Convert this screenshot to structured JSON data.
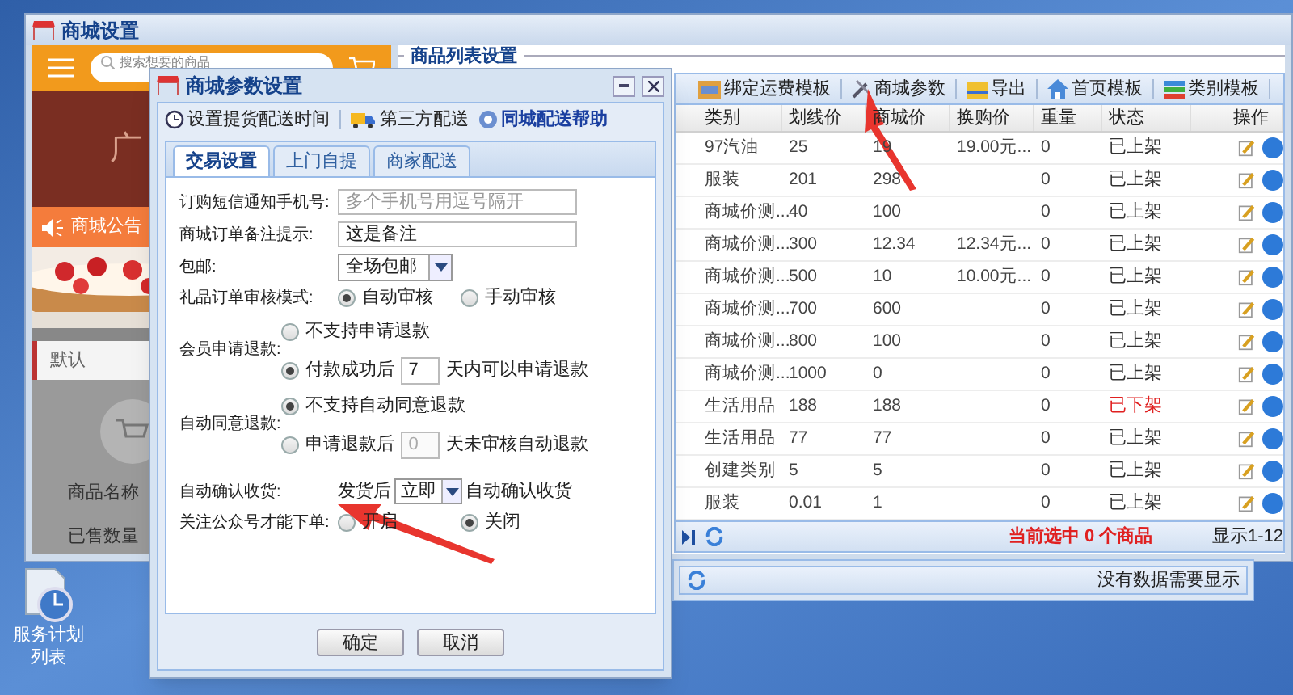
{
  "desktop_icon": {
    "label": "服务计划列表"
  },
  "main_window": {
    "title": "商城设置"
  },
  "preview": {
    "search": {
      "placeholder": "搜索想要的商品"
    },
    "banner": "广",
    "notice": "商城公告",
    "category": "默认",
    "product_name": "商品名称",
    "sold_count": "已售数量"
  },
  "product_list": {
    "title": "商品列表设置",
    "toolbar": [
      "绑定运费模板",
      "商城参数",
      "导出",
      "首页模板",
      "类别模板"
    ],
    "columns": [
      "类别",
      "划线价",
      "商城价",
      "换购价",
      "重量",
      "状态",
      "操作"
    ],
    "rows": [
      {
        "cells": [
          "97汽油",
          "25",
          "19",
          "19.00元...",
          "0"
        ],
        "status": "已上架",
        "listed": true
      },
      {
        "cells": [
          "服装",
          "201",
          "298",
          "",
          "0"
        ],
        "status": "已上架",
        "listed": true
      },
      {
        "cells": [
          "商城价测...",
          "40",
          "100",
          "",
          "0"
        ],
        "status": "已上架",
        "listed": true
      },
      {
        "cells": [
          "商城价测...",
          "300",
          "12.34",
          "12.34元...",
          "0"
        ],
        "status": "已上架",
        "listed": true
      },
      {
        "cells": [
          "商城价测...",
          "500",
          "10",
          "10.00元...",
          "0"
        ],
        "status": "已上架",
        "listed": true
      },
      {
        "cells": [
          "商城价测...",
          "700",
          "600",
          "",
          "0"
        ],
        "status": "已上架",
        "listed": true
      },
      {
        "cells": [
          "商城价测...",
          "800",
          "100",
          "",
          "0"
        ],
        "status": "已上架",
        "listed": true
      },
      {
        "cells": [
          "商城价测...",
          "1000",
          "0",
          "",
          "0"
        ],
        "status": "已上架",
        "listed": true
      },
      {
        "cells": [
          "生活用品",
          "188",
          "188",
          "",
          "0"
        ],
        "status": "已下架",
        "listed": false
      },
      {
        "cells": [
          "生活用品",
          "77",
          "77",
          "",
          "0"
        ],
        "status": "已上架",
        "listed": true
      },
      {
        "cells": [
          "创建类别",
          "5",
          "5",
          "",
          "0"
        ],
        "status": "已上架",
        "listed": true
      },
      {
        "cells": [
          "服装",
          "0.01",
          "1",
          "",
          "0"
        ],
        "status": "已上架",
        "listed": true
      }
    ],
    "selection": "当前选中 0 个商品",
    "range": "显示1-12",
    "empty_message": "没有数据需要显示"
  },
  "dialog": {
    "title": "商城参数设置",
    "toolbar": [
      {
        "kind": "clock",
        "label": "设置提货配送时间"
      },
      {
        "kind": "truck",
        "label": "第三方配送"
      },
      {
        "kind": "help",
        "label": "同城配送帮助"
      }
    ],
    "tabs": [
      {
        "label": "交易设置",
        "selected": true
      },
      {
        "label": "上门自提",
        "selected": false
      },
      {
        "label": "商家配送",
        "selected": false
      }
    ],
    "fields": [
      {
        "kind": "input",
        "label": "订购短信通知手机号:",
        "placeholder": "多个手机号用逗号隔开"
      },
      {
        "kind": "input",
        "label": "商城订单备注提示:",
        "value": "这是备注"
      },
      {
        "kind": "select",
        "label": "包邮:",
        "value": "全场包邮"
      },
      {
        "kind": "radio",
        "label": "礼品订单审核模式:",
        "options": [
          {
            "label": "自动审核",
            "selected": true
          },
          {
            "label": "手动审核",
            "selected": false
          }
        ]
      },
      {
        "kind": "radio-stack",
        "label": "会员申请退款:",
        "options": [
          {
            "label": "不支持申请退款",
            "selected": false
          },
          {
            "label": "付款成功后",
            "input": {
              "value": "7",
              "disabled": false
            },
            "suffix": "天内可以申请退款",
            "selected": true
          }
        ]
      },
      {
        "kind": "radio-stack",
        "label": "自动同意退款:",
        "options": [
          {
            "label": "不支持自动同意退款",
            "selected": true
          },
          {
            "label": "申请退款后",
            "input": {
              "value": "0",
              "disabled": true
            },
            "suffix": "天未审核自动退款",
            "selected": false
          }
        ]
      },
      {
        "kind": "inline-select",
        "label": "自动确认收货:",
        "prefix": "发货后",
        "value": "立即",
        "suffix": "自动确认收货"
      },
      {
        "kind": "radio",
        "label": "关注公众号才能下单:",
        "options": [
          {
            "label": "开启",
            "selected": false
          },
          {
            "label": "关闭",
            "selected": true
          }
        ]
      }
    ],
    "buttons": [
      "确定",
      "取消"
    ]
  }
}
